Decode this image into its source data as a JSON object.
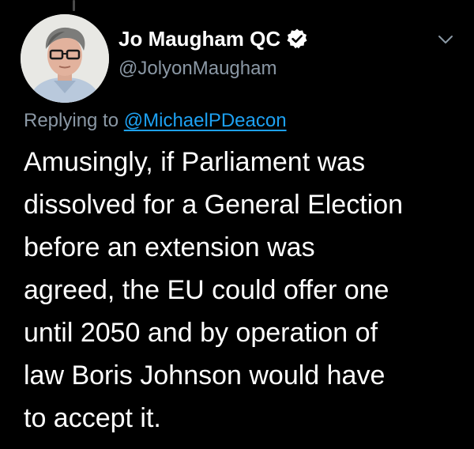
{
  "tweet": {
    "author": {
      "display_name": "Jo Maugham QC",
      "handle": "@JolyonMaugham"
    },
    "reply": {
      "prefix": "Replying to",
      "to_handle": "@MichaelPDeacon"
    },
    "text_lines": [
      "Amusingly, if Parliament was",
      "dissolved for a General Election",
      "before an extension was",
      "agreed, the EU could offer one",
      "until 2050 and by operation of",
      "law Boris Johnson would have",
      "to accept it."
    ]
  },
  "icons": {
    "verified": "verified-badge-icon",
    "more": "chevron-down-icon"
  },
  "colors": {
    "background": "#000000",
    "text": "#ffffff",
    "secondary": "#8b98a5",
    "link": "#1da1f2"
  }
}
